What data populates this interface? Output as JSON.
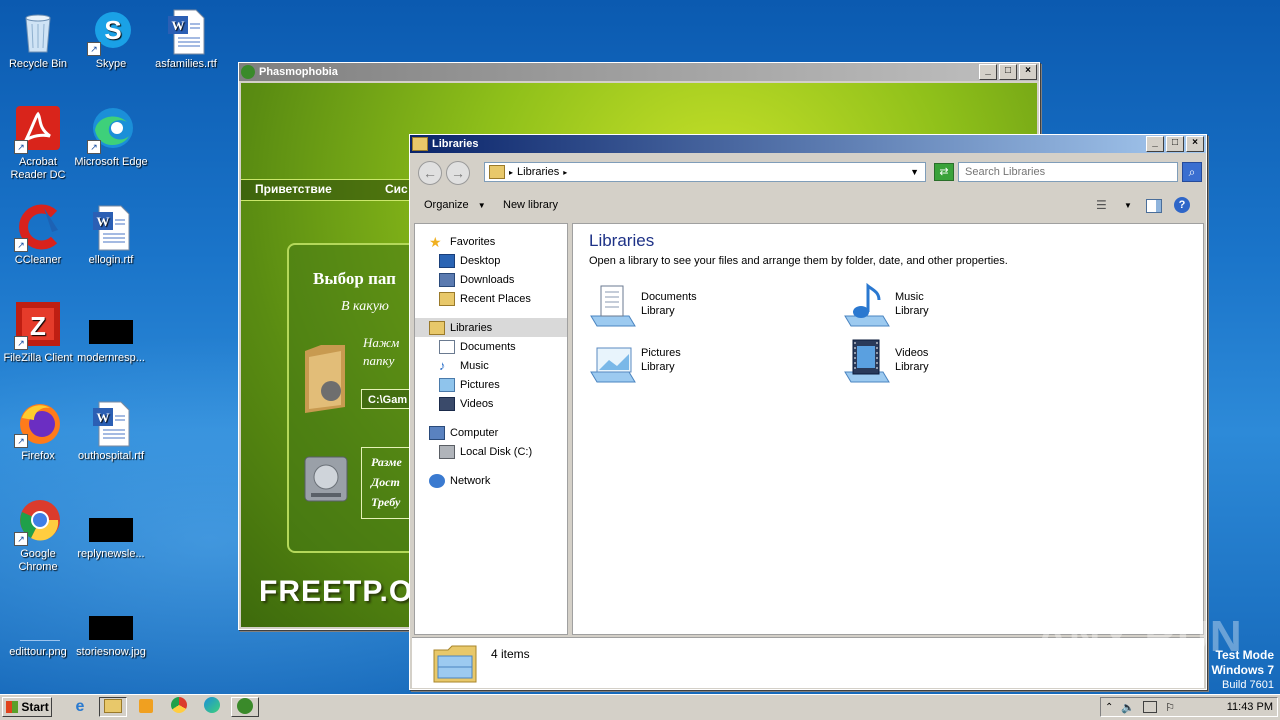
{
  "desktop": {
    "icons": [
      {
        "label": "Recycle Bin"
      },
      {
        "label": "Skype"
      },
      {
        "label": "asfamilies.rtf"
      },
      {
        "label": "Acrobat Reader DC"
      },
      {
        "label": "Microsoft Edge"
      },
      {
        "label": "CCleaner"
      },
      {
        "label": "ellogin.rtf"
      },
      {
        "label": "FileZilla Client"
      },
      {
        "label": "modernresp..."
      },
      {
        "label": "Firefox"
      },
      {
        "label": "outhospital.rtf"
      },
      {
        "label": "Google Chrome"
      },
      {
        "label": "replynewsle..."
      },
      {
        "label": "edittour.png"
      },
      {
        "label": "storiesnow.jpg"
      }
    ],
    "watermark": {
      "brand": "ANY RUN",
      "mode": "Test Mode",
      "os": "Windows 7",
      "build": "Build 7601"
    }
  },
  "installer": {
    "title": "Phasmophobia",
    "menu": [
      "Приветствие",
      "Сис"
    ],
    "heading": "Выбор пап",
    "subheading": "В какую",
    "instruction_line1": "Нажм",
    "instruction_line2": "папку",
    "path_value": "C:\\Gam",
    "disk_line1": "Разме",
    "disk_line2": "Дост",
    "disk_line3": "Требу",
    "brand": "FREETP.OR"
  },
  "explorer": {
    "title": "Libraries",
    "address": {
      "path": "Libraries"
    },
    "search": {
      "placeholder": "Search Libraries"
    },
    "toolbar": {
      "organize": "Organize",
      "new_library": "New library"
    },
    "nav": {
      "favorites": "Favorites",
      "favorites_items": [
        "Desktop",
        "Downloads",
        "Recent Places"
      ],
      "libraries": "Libraries",
      "libraries_items": [
        "Documents",
        "Music",
        "Pictures",
        "Videos"
      ],
      "computer": "Computer",
      "computer_items": [
        "Local Disk (C:)"
      ],
      "network": "Network"
    },
    "content": {
      "heading": "Libraries",
      "subtitle": "Open a library to see your files and arrange them by folder, date, and other properties.",
      "libraries": [
        {
          "name": "Documents",
          "type": "Library"
        },
        {
          "name": "Music",
          "type": "Library"
        },
        {
          "name": "Pictures",
          "type": "Library"
        },
        {
          "name": "Videos",
          "type": "Library"
        }
      ]
    },
    "status": {
      "count": "4 items"
    }
  },
  "taskbar": {
    "start": "Start",
    "time": "11:43 PM"
  }
}
